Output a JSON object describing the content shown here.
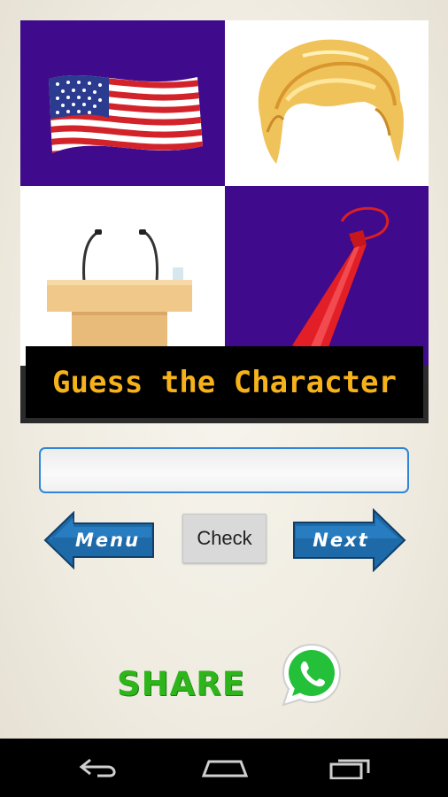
{
  "puzzle": {
    "title": "Guess the Character",
    "tiles": [
      {
        "name": "flag",
        "icon": "us-flag-icon"
      },
      {
        "name": "hair",
        "icon": "blonde-hair-icon"
      },
      {
        "name": "podium",
        "icon": "podium-microphones-icon"
      },
      {
        "name": "tie",
        "icon": "red-tie-icon"
      }
    ],
    "colors": {
      "tile_purple": "#3f0a8c",
      "title_text": "#f6b21b"
    }
  },
  "answer": {
    "value": "",
    "placeholder": ""
  },
  "buttons": {
    "menu_label": "Menu",
    "check_label": "Check",
    "next_label": "Next"
  },
  "share": {
    "label": "SHARE",
    "icon": "whatsapp-icon"
  },
  "navbar": {
    "icons": [
      "back-icon",
      "home-icon",
      "recents-icon"
    ]
  }
}
